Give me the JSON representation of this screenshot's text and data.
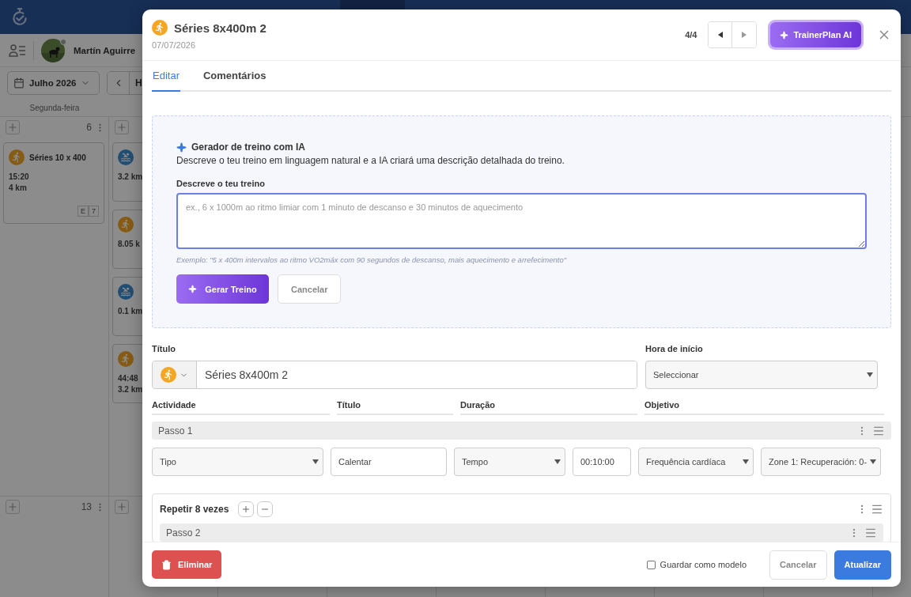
{
  "app": {
    "user": "Martín Aguirre",
    "month": "Julho 2026",
    "nav_label": "H",
    "weekday": "Segunda-feira"
  },
  "calendar": {
    "weeks": [
      {
        "days": [
          {
            "number": "6",
            "cards": [
              {
                "kind": "run",
                "title": "Séries 10 x 400",
                "lines": [
                  "15:20",
                  "4 km"
                ],
                "tags": [
                  "E",
                  "7"
                ]
              }
            ]
          },
          {
            "cards": [
              {
                "kind": "swim",
                "lines": [
                  "3.2 km"
                ]
              },
              {
                "kind": "run",
                "lines": [
                  "8.05 k"
                ]
              },
              {
                "kind": "swim",
                "lines": [
                  "0.1 km"
                ]
              },
              {
                "kind": "run",
                "lines": [
                  "44:48",
                  "3.2 km"
                ]
              }
            ]
          }
        ]
      },
      {
        "days": [
          {
            "number": "13"
          }
        ]
      }
    ]
  },
  "dialog": {
    "badge": {
      "kind": "run"
    },
    "title": "Séries 8x400m 2",
    "date": "07/07/2026",
    "counter": "4/4",
    "ai_button": "TrainerPlan AI",
    "tabs": [
      {
        "label": "Editar",
        "selected": true
      },
      {
        "label": "Comentários",
        "selected": false
      }
    ],
    "ai_generator": {
      "heading": "Gerador de treino com IA",
      "description": "Descreve o teu treino em linguagem natural e a IA criará uma descrição detalhada do treino.",
      "field_label": "Descreve o teu treino",
      "placeholder": "ex., 6 x 1000m ao ritmo limiar com 1 minuto de descanso e 30 minutos de aquecimento",
      "example": "Exemplo: \"5 x 400m intervalos ao ritmo VO2máx com 90 segundos de descanso, mais aquecimento e arrefecimento\"",
      "generate": "Gerar Treino",
      "cancel": "Cancelar"
    },
    "title_label": "Título",
    "title_value": "Séries 8x400m 2",
    "start_label": "Hora de início",
    "start_value": "Seleccionar",
    "columns": [
      "Actividade",
      "Título",
      "Duração",
      "Objetivo"
    ],
    "steps": [
      {
        "kind": "step",
        "label": "Passo 1",
        "fields": [
          {
            "kind": "select",
            "value": "Tipo"
          },
          {
            "kind": "input",
            "value": "Calentar"
          },
          {
            "kind": "select",
            "value": "Tempo"
          },
          {
            "kind": "input",
            "value": "00:10:00"
          },
          {
            "kind": "select",
            "value": "Frequência cardíaca"
          },
          {
            "kind": "select",
            "value": "Zone 1: Recuperación: 0-"
          }
        ]
      },
      {
        "kind": "repeat",
        "label": "Repetir 8 vezes",
        "children": [
          {
            "kind": "step",
            "label": "Passo 2"
          }
        ]
      }
    ],
    "footer": {
      "delete": "Eliminar",
      "template": {
        "label": "Guardar como modelo",
        "checked": false
      },
      "cancel": "Cancelar",
      "submit": "Atualizar"
    }
  }
}
